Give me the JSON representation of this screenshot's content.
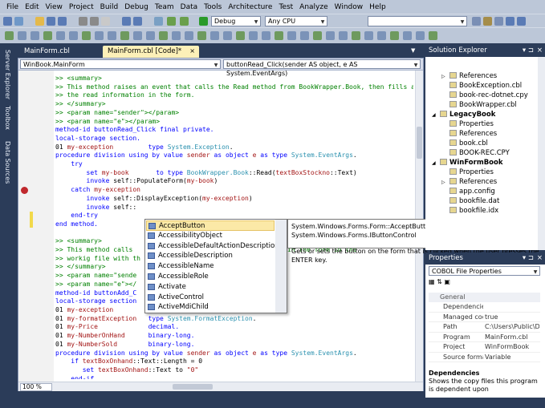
{
  "menu": [
    "File",
    "Edit",
    "View",
    "Project",
    "Build",
    "Debug",
    "Team",
    "Data",
    "Tools",
    "Architecture",
    "Test",
    "Analyze",
    "Window",
    "Help"
  ],
  "toolbar": {
    "config": "Debug",
    "platform": "Any CPU",
    "find": ""
  },
  "left_tabs": [
    "Server Explorer",
    "Toolbox",
    "Data Sources"
  ],
  "tabs": {
    "design": "MainForm.cbl [Design]*",
    "code": "MainForm.cbl [Code]*"
  },
  "nav": {
    "class": "WinBook.MainForm",
    "member": "buttonRead_Click(sender AS object, e AS System.EventArgs)"
  },
  "zoom": "100 %",
  "code": [
    [
      [
        "c",
        ">> <summary>"
      ]
    ],
    [
      [
        "c",
        ">> This method raises an event that calls the Read method from BookWrapper.Book, then fills a"
      ]
    ],
    [
      [
        "c",
        ">> the read information in the form."
      ]
    ],
    [
      [
        "c",
        ">> </summary>"
      ]
    ],
    [
      [
        "c",
        ">> <param name=\"sender\"></param>"
      ]
    ],
    [
      [
        "c",
        ">> <param name=\"e\"></param>"
      ]
    ],
    [
      [
        "k",
        "method-id buttonRead_Click final private."
      ]
    ],
    [
      [
        "k",
        "local-storage section."
      ]
    ],
    [
      [
        "",
        "01 "
      ],
      [
        "r",
        "my-exception"
      ],
      [
        "",
        ""
      ],
      [
        "k",
        "         type "
      ],
      [
        "t",
        "System.Exception"
      ],
      [
        "",
        "."
      ]
    ],
    [
      [
        "k",
        "procedure division using by value "
      ],
      [
        "r",
        "sender"
      ],
      [
        "k",
        " as object "
      ],
      [
        "r",
        "e"
      ],
      [
        "k",
        " as type "
      ],
      [
        "t",
        "System.EventArgs"
      ],
      [
        "",
        "."
      ]
    ],
    [
      [
        "k",
        "    try"
      ]
    ],
    [
      [
        "k",
        "        set "
      ],
      [
        "r",
        "my-book"
      ],
      [
        "k",
        "       to type "
      ],
      [
        "t",
        "BookWrapper.Book"
      ],
      [
        "",
        "::Read("
      ],
      [
        "r",
        "textBoxStockno"
      ],
      [
        "",
        "::Text)"
      ]
    ],
    [
      [
        "k",
        "        invoke "
      ],
      [
        "",
        "self::PopulateForm("
      ],
      [
        "r",
        "my-book"
      ],
      [
        "",
        ")"
      ]
    ],
    [
      [
        "k",
        "    catch "
      ],
      [
        "r",
        "my-exception"
      ]
    ],
    [
      [
        "k",
        "        invoke "
      ],
      [
        "",
        "self::DisplayException("
      ],
      [
        "r",
        "my-exception"
      ],
      [
        "",
        ")"
      ]
    ],
    [
      [
        "k",
        "        invoke "
      ],
      [
        "",
        "self::"
      ]
    ],
    [
      [
        "k",
        "    end-try"
      ]
    ],
    [
      [
        "k",
        "end method."
      ]
    ],
    [
      [
        "",
        ""
      ]
    ],
    [
      [
        "c",
        ">> <summary>"
      ]
    ],
    [
      [
        "c",
        ">> This method calls                         rmation filled in the form in the"
      ]
    ],
    [
      [
        "c",
        ">> workig file with th"
      ]
    ],
    [
      [
        "c",
        ">> </summary>"
      ]
    ],
    [
      [
        "c",
        ">> <param name=\"sende"
      ]
    ],
    [
      [
        "c",
        ">> <param name=\"e\"></"
      ]
    ],
    [
      [
        "k",
        "method-id buttonAdd_C"
      ]
    ],
    [
      [
        "k",
        "local-storage section"
      ]
    ],
    [
      [
        "",
        "01 "
      ],
      [
        "r",
        "my-exception"
      ],
      [
        "k",
        "         type "
      ],
      [
        "t",
        "System.Exception"
      ],
      [
        "",
        "."
      ]
    ],
    [
      [
        "",
        "01 "
      ],
      [
        "r",
        "my-formatException"
      ],
      [
        "k",
        "   type "
      ],
      [
        "t",
        "System.FormatException"
      ],
      [
        "",
        "."
      ]
    ],
    [
      [
        "",
        "01 "
      ],
      [
        "r",
        "my-Price"
      ],
      [
        "k",
        "             decimal."
      ]
    ],
    [
      [
        "",
        "01 "
      ],
      [
        "r",
        "my-NumberOnHand"
      ],
      [
        "k",
        "      binary-long."
      ]
    ],
    [
      [
        "",
        "01 "
      ],
      [
        "r",
        "my-NumberSold"
      ],
      [
        "k",
        "        binary-long."
      ]
    ],
    [
      [
        "k",
        "procedure division using by value "
      ],
      [
        "r",
        "sender"
      ],
      [
        "k",
        " as object "
      ],
      [
        "r",
        "e"
      ],
      [
        "k",
        " as type "
      ],
      [
        "t",
        "System.EventArgs"
      ],
      [
        "",
        "."
      ]
    ],
    [
      [
        "k",
        "    if "
      ],
      [
        "r",
        "textBoxOnhand"
      ],
      [
        "",
        "::Text::Length = 0"
      ]
    ],
    [
      [
        "k",
        "       set "
      ],
      [
        "r",
        "textBoxOnhand"
      ],
      [
        "",
        "::Text to "
      ],
      [
        "r",
        "\"0\""
      ]
    ],
    [
      [
        "k",
        "    end-if"
      ]
    ]
  ],
  "autocomplete": {
    "items": [
      "AcceptButton",
      "AccessibilityObject",
      "AccessibleDefaultActionDescription",
      "AccessibleDescription",
      "AccessibleName",
      "AccessibleRole",
      "Activate",
      "ActiveControl",
      "ActiveMdiChild"
    ],
    "selected": 0
  },
  "tooltip": {
    "signature": "System.Windows.Forms.Form::AcceptButton AS System.Windows.Forms.IButtonControl",
    "description": "Gets or sets the button on the form that is clicked when the user presses the ENTER key."
  },
  "solution_explorer": {
    "title": "Solution Explorer",
    "items": [
      {
        "label": "References",
        "indent": 2,
        "expander": "▷",
        "bold": false
      },
      {
        "label": "BookException.cbl",
        "indent": 2,
        "expander": "",
        "bold": false
      },
      {
        "label": "book-rec-dotnet.cpy",
        "indent": 2,
        "expander": "",
        "bold": false
      },
      {
        "label": "BookWrapper.cbl",
        "indent": 2,
        "expander": "",
        "bold": false
      },
      {
        "label": "LegacyBook",
        "indent": 1,
        "expander": "◢",
        "bold": true
      },
      {
        "label": "Properties",
        "indent": 2,
        "expander": "",
        "bold": false
      },
      {
        "label": "References",
        "indent": 2,
        "expander": "",
        "bold": false
      },
      {
        "label": "book.cbl",
        "indent": 2,
        "expander": "",
        "bold": false
      },
      {
        "label": "BOOK-REC.CPY",
        "indent": 2,
        "expander": "",
        "bold": false
      },
      {
        "label": "WinFormBook",
        "indent": 1,
        "expander": "◢",
        "bold": true
      },
      {
        "label": "Properties",
        "indent": 2,
        "expander": "",
        "bold": false
      },
      {
        "label": "References",
        "indent": 2,
        "expander": "▷",
        "bold": false
      },
      {
        "label": "app.config",
        "indent": 2,
        "expander": "",
        "bold": false
      },
      {
        "label": "bookfile.dat",
        "indent": 2,
        "expander": "",
        "bold": false
      },
      {
        "label": "bookfile.idx",
        "indent": 2,
        "expander": "",
        "bold": false
      }
    ]
  },
  "properties": {
    "title": "Properties",
    "object": "COBOL File Properties",
    "category": "General",
    "rows": [
      {
        "name": "Dependencies",
        "value": ""
      },
      {
        "name": "Managed code",
        "value": "true"
      },
      {
        "name": "Path",
        "value": "C:\\Users\\Public\\Do"
      },
      {
        "name": "Program",
        "value": "MainForm.cbl"
      },
      {
        "name": "Project",
        "value": "WinFormBook"
      },
      {
        "name": "Source format",
        "value": "Variable"
      }
    ],
    "desc_title": "Dependencies",
    "desc_text": "Shows the copy files this program is dependent upon"
  }
}
